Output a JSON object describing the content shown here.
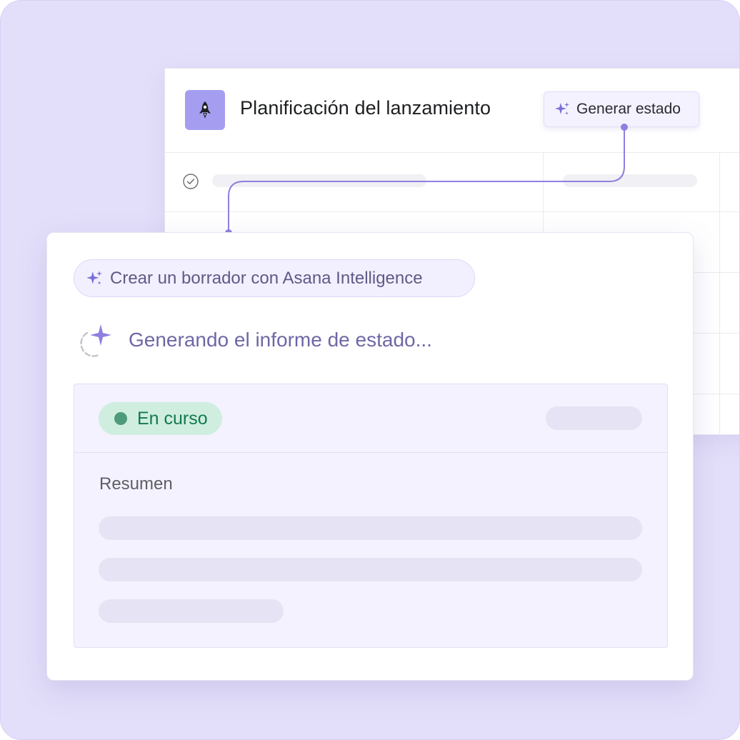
{
  "project": {
    "title": "Planificación del lanzamiento",
    "icon": "rocket-icon",
    "generate_button": "Generar estado",
    "accent_icon_bg": "#a59ef0"
  },
  "card": {
    "ai_chip_label": "Crear un borrador con Asana Intelligence",
    "generating_text": "Generando el informe de estado...",
    "status_badge": "En curso",
    "summary_label": "Resumen"
  },
  "colors": {
    "background": "#e3dffa",
    "accent": "#8f7fe0",
    "status_green_bg": "#cfeee0",
    "status_green_text": "#13794f"
  }
}
